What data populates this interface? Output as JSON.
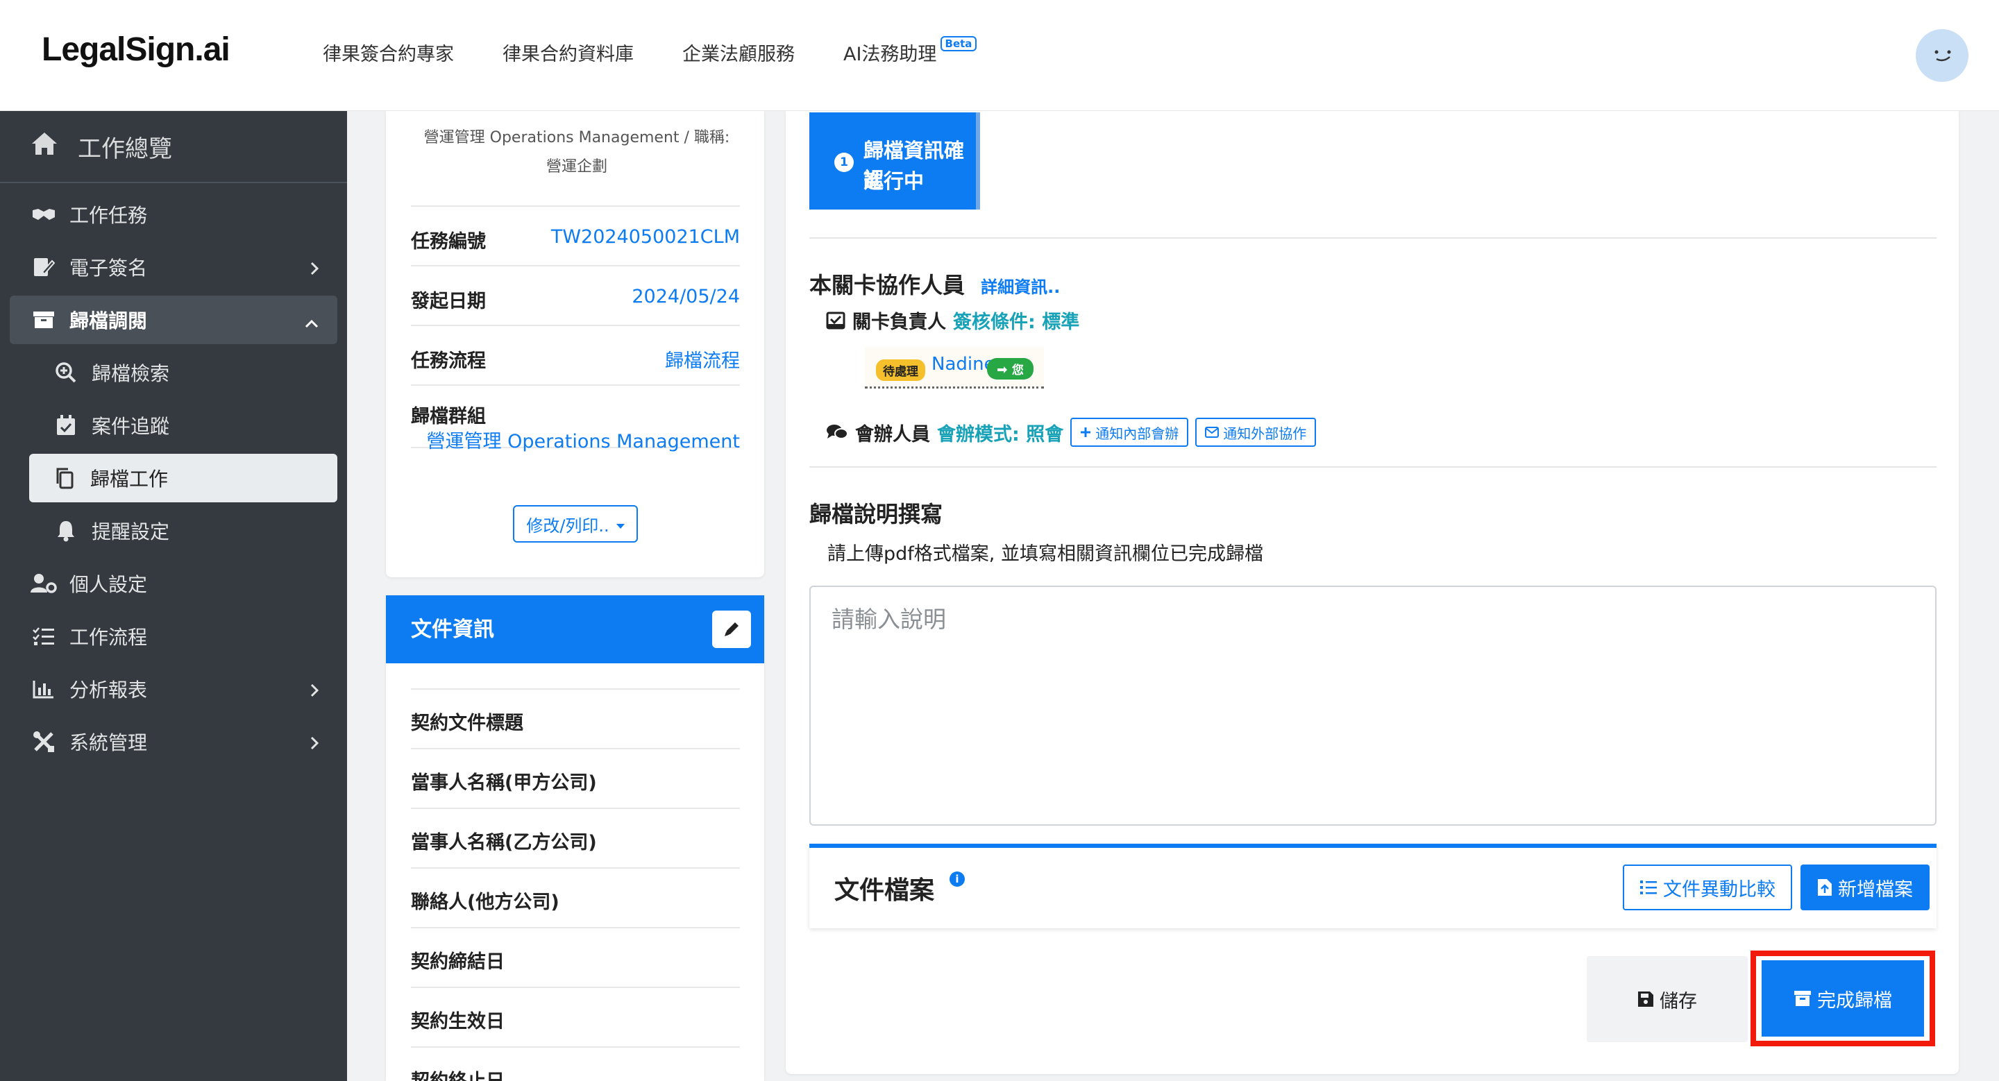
{
  "app": {
    "logo": "LegalSign.ai"
  },
  "topnav": [
    {
      "label": "律果簽合約專家"
    },
    {
      "label": "律果合約資料庫"
    },
    {
      "label": "企業法顧服務"
    },
    {
      "label": "AI法務助理",
      "badge": "Beta"
    }
  ],
  "sidebar": {
    "header": "工作總覽",
    "items": [
      {
        "label": "工作任務",
        "icon": "handshake-icon"
      },
      {
        "label": "電子簽名",
        "icon": "signature-icon"
      },
      {
        "label": "歸檔調閱",
        "icon": "archive-icon"
      },
      {
        "label": "歸檔檢索",
        "icon": "search-plus-icon"
      },
      {
        "label": "案件追蹤",
        "icon": "calendar-check-icon"
      },
      {
        "label": "歸檔工作",
        "icon": "copy-icon"
      },
      {
        "label": "提醒設定",
        "icon": "bell-icon"
      },
      {
        "label": "個人設定",
        "icon": "user-cog-icon"
      },
      {
        "label": "工作流程",
        "icon": "list-check-icon"
      },
      {
        "label": "分析報表",
        "icon": "chart-bar-icon"
      },
      {
        "label": "系統管理",
        "icon": "tools-icon"
      }
    ]
  },
  "task": {
    "dept_line1": "營運管理 Operations Management / 職稱:",
    "dept_line2": "營運企劃",
    "rows": [
      {
        "label": "任務編號",
        "value": "TW2024050021CLM"
      },
      {
        "label": "發起日期",
        "value": "2024/05/24"
      },
      {
        "label": "任務流程",
        "value": "歸檔流程"
      }
    ],
    "group_label": "歸檔群組",
    "group_value": "營運管理 Operations Management",
    "action_button": "修改/列印.."
  },
  "doc_info": {
    "title": "文件資訊",
    "fields": [
      "契約文件標題",
      "當事人名稱(甲方公司)",
      "當事人名稱(乙方公司)",
      "聯絡人(他方公司)",
      "契約締結日",
      "契約生效日",
      "契約終止日"
    ]
  },
  "step": {
    "number": "1",
    "line1": "歸檔資訊確認",
    "line2": "進行中"
  },
  "collab": {
    "title": "本關卡協作人員",
    "detail_link": "詳細資訊..",
    "owner_label": "關卡負責人",
    "owner_condition": "簽核條件: 標準",
    "assignee_status": "待處理",
    "assignee_name": "Nadine",
    "assignee_you": "您",
    "cosign_label": "會辦人員",
    "cosign_mode": "會辦模式: 照會",
    "notify_internal": "通知內部會辦",
    "notify_external": "通知外部協作"
  },
  "archive": {
    "title": "歸檔說明撰寫",
    "instruction": "請上傳pdf格式檔案, 並填寫相關資訊欄位已完成歸檔",
    "placeholder": "請輸入說明"
  },
  "files": {
    "title": "文件檔案",
    "compare_button": "文件異動比較",
    "add_button": "新增檔案"
  },
  "actions": {
    "save": "儲存",
    "complete": "完成歸檔"
  },
  "colors": {
    "primary": "#0d7cf2",
    "sidebar": "#343a40",
    "highlight": "#f21a0a",
    "success": "#28a745",
    "warning": "#f5c02b",
    "teal": "#17a2b8"
  }
}
